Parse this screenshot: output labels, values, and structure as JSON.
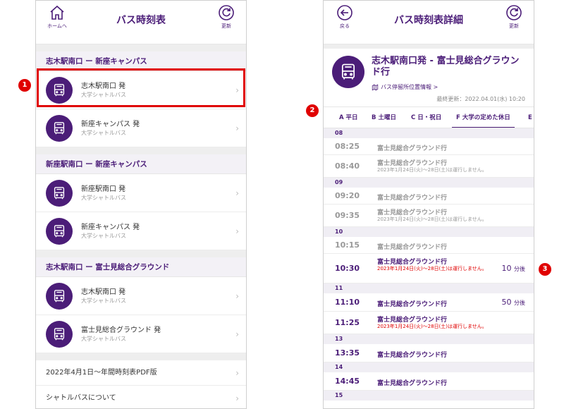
{
  "left": {
    "header": {
      "title": "バス時刻表",
      "home_label": "ホームへ",
      "refresh_label": "更新"
    },
    "sections": [
      {
        "title": "志木駅南口 ー 新座キャンパス",
        "items": [
          {
            "name": "志木駅南口 発",
            "sub": "大学シャトルバス"
          },
          {
            "name": "新座キャンパス 発",
            "sub": "大学シャトルバス"
          }
        ]
      },
      {
        "title": "新座駅南口 ー 新座キャンパス",
        "items": [
          {
            "name": "新座駅南口 発",
            "sub": "大学シャトルバス"
          },
          {
            "name": "新座キャンパス 発",
            "sub": "大学シャトルバス"
          }
        ]
      },
      {
        "title": "志木駅南口 ー 富士見総合グラウンド",
        "items": [
          {
            "name": "志木駅南口 発",
            "sub": "大学シャトルバス"
          },
          {
            "name": "富士見総合グラウンド 発",
            "sub": "大学シャトルバス"
          }
        ]
      }
    ],
    "links": [
      "2022年4月1日〜年間時刻表PDF版",
      "シャトルバスについて"
    ]
  },
  "right": {
    "header": {
      "title": "バス時刻表詳細",
      "back_label": "戻る",
      "refresh_label": "更新"
    },
    "route_title": "志木駅南口発 - 富士見総合グラウンド行",
    "stop_link": "バス停留所位置情報 >",
    "updated": "最終更新：2022.04.01(水) 10:20",
    "tabs": [
      "A 平日",
      "B 土曜日",
      "C 日・祝日",
      "F 大学の定めた休日",
      "E 上"
    ],
    "rows": [
      {
        "type": "hour",
        "label": "08"
      },
      {
        "type": "dep",
        "time": "08:25",
        "dest": "富士見総合グラウンド行",
        "note": ""
      },
      {
        "type": "dep",
        "time": "08:40",
        "dest": "富士見総合グラウンド行",
        "note": "2023年1月24日(火)〜28日(土)は運行しません。"
      },
      {
        "type": "hour",
        "label": "09"
      },
      {
        "type": "dep",
        "time": "09:20",
        "dest": "富士見総合グラウンド行",
        "note": ""
      },
      {
        "type": "dep",
        "time": "09:35",
        "dest": "富士見総合グラウンド行",
        "note": "2023年1月24日(火)〜28日(土)は運行しません。"
      },
      {
        "type": "hour",
        "label": "10"
      },
      {
        "type": "dep",
        "time": "10:15",
        "dest": "富士見総合グラウンド行",
        "note": ""
      },
      {
        "type": "dep",
        "time": "10:30",
        "dest": "富士見総合グラウンド行",
        "note": "2023年1月24日(火)〜28日(土)は運行しません。",
        "count": "10",
        "unit": "分後",
        "active": true
      },
      {
        "type": "hour",
        "label": "11"
      },
      {
        "type": "dep",
        "time": "11:10",
        "dest": "富士見総合グラウンド行",
        "note": "",
        "count": "50",
        "unit": "分後",
        "active": true
      },
      {
        "type": "dep",
        "time": "11:25",
        "dest": "富士見総合グラウンド行",
        "note": "2023年1月24日(火)〜28日(土)は運行しません。",
        "active": true
      },
      {
        "type": "hour",
        "label": "13"
      },
      {
        "type": "dep",
        "time": "13:35",
        "dest": "富士見総合グラウンド行",
        "note": "",
        "active": true
      },
      {
        "type": "hour",
        "label": "14"
      },
      {
        "type": "dep",
        "time": "14:45",
        "dest": "富士見総合グラウンド行",
        "note": "",
        "active": true
      },
      {
        "type": "hour",
        "label": "15"
      }
    ]
  },
  "markers": [
    "1",
    "2",
    "3"
  ],
  "colors": {
    "brand": "#4b1d78",
    "alert": "#e00000",
    "muted": "#999999"
  },
  "icons": {
    "home": "home-icon",
    "refresh": "refresh-icon",
    "back": "back-arrow-icon",
    "bus": "bus-icon",
    "chevron": "chevron-right-icon",
    "map": "map-icon"
  }
}
